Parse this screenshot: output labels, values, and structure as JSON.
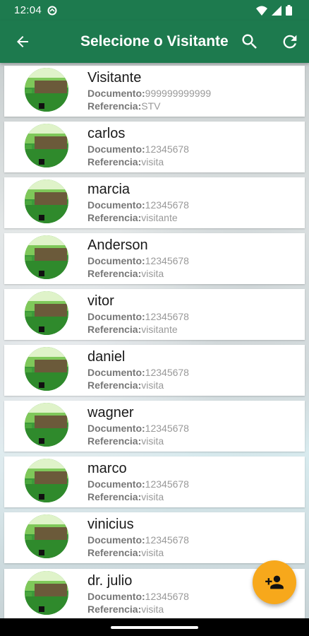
{
  "status": {
    "time": "12:04"
  },
  "toolbar": {
    "title": "Selecione o Visitante"
  },
  "labels": {
    "documento": "Documento:",
    "referencia": "Referencia:"
  },
  "visitors": [
    {
      "name": "Visitante",
      "documento": "999999999999",
      "referencia": "STV"
    },
    {
      "name": "carlos",
      "documento": "12345678",
      "referencia": "visita"
    },
    {
      "name": "marcia",
      "documento": "12345678",
      "referencia": "visitante"
    },
    {
      "name": "Anderson",
      "documento": "12345678",
      "referencia": "visita"
    },
    {
      "name": "vitor",
      "documento": "12345678",
      "referencia": "visitante"
    },
    {
      "name": "daniel",
      "documento": "12345678",
      "referencia": "visita"
    },
    {
      "name": "wagner",
      "documento": "12345678",
      "referencia": "visita"
    },
    {
      "name": "marco",
      "documento": "12345678",
      "referencia": "visita"
    },
    {
      "name": "vinicius",
      "documento": "12345678",
      "referencia": "visita"
    },
    {
      "name": "dr. julio",
      "documento": "12345678",
      "referencia": "visita"
    }
  ],
  "colors": {
    "primary": "#1d7a4e",
    "fab": "#f7a81b"
  },
  "icons": {
    "back": "arrow-left-icon",
    "search": "search-icon",
    "refresh": "refresh-icon",
    "fab": "add-person-icon"
  }
}
